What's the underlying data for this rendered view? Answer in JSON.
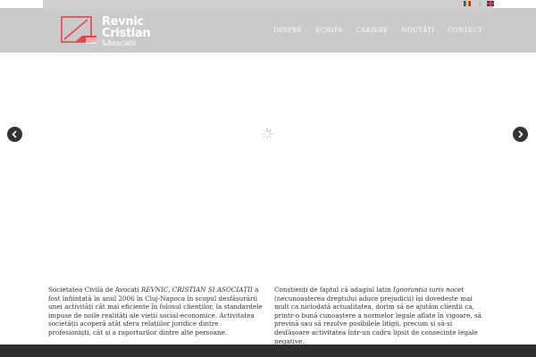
{
  "languages": [
    {
      "code": "ro",
      "icon": "romania-flag-icon"
    },
    {
      "code": "en",
      "icon": "uk-flag-icon"
    }
  ],
  "language_separator": "|",
  "logo": {
    "line1": "Revnic",
    "line2": "Cristian",
    "line3": "&Asociații",
    "accent_color": "#e8434b"
  },
  "nav": {
    "items": [
      "DESPRE",
      "ECHIPA",
      "CARIERE",
      "NOUTĂȚI",
      "CONTACT"
    ]
  },
  "slider": {
    "prev_icon": "chevron-left-icon",
    "next_icon": "chevron-right-icon",
    "loading_icon": "spinner-icon"
  },
  "content": {
    "left": {
      "p1": "Societatea Civilă de Avocați ",
      "firm": "REVNIC, CRISTIAN ȘI ASOCIAȚII",
      "p2": " a fost înființată în anul 2006 în Cluj-Napoca în scopul desfășurării unei activități cât mai eficiente în folosul clienților, la standardele impuse de noile realități ale vieții social-economice. Activitatea societății acoperă atât sfera relațiilor juridice dintre profesioniști, cât și a raporturilor dintre alte persoane."
    },
    "right": {
      "p1": "Conștienți de faptul că adagiul latin ",
      "latin": "Ignorantia iuris nocet",
      "p2": " (necunoașterea dreptului aduce prejudicii) își dovedește mai mult ca niciodată actualitatea, dorim să ne ajutăm clienții ca, printr-o bună cunoaștere a normelor legale aflate în vigoare, să prevină sau să rezolve posibilele litigii, precum și să-și desfășoare activitatea într-un cadru lipsit de consecințe legale negative."
    }
  },
  "colors": {
    "header_bg": "#cacaca",
    "footer_bg": "#2e2e2e",
    "arrow_bg": "#333333"
  }
}
